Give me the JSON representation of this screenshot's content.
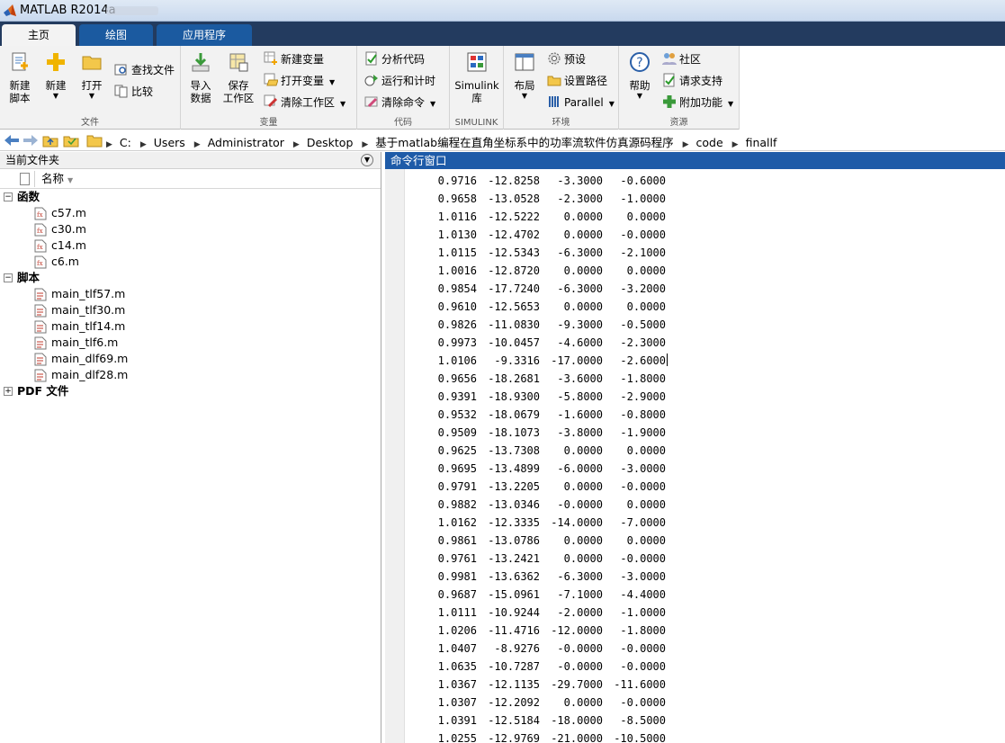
{
  "window": {
    "title": "MATLAB R2014a"
  },
  "tabs": [
    {
      "label": "主页",
      "active": true
    },
    {
      "label": "绘图",
      "active": false
    },
    {
      "label": "应用程序",
      "active": false
    }
  ],
  "ribbon": {
    "file_group": {
      "label": "文件",
      "new_script": "新建\n脚本",
      "new": "新建",
      "open": "打开",
      "find_files": "查找文件",
      "compare": "比较"
    },
    "variable_group": {
      "label": "变量",
      "import_data": "导入\n数据",
      "save_workspace": "保存\n工作区",
      "new_variable": "新建变量",
      "open_variable": "打开变量",
      "clear_workspace": "清除工作区"
    },
    "code_group": {
      "label": "代码",
      "analyze_code": "分析代码",
      "run_and_time": "运行和计时",
      "clear_commands": "清除命令"
    },
    "simulink_group": {
      "label": "SIMULINK",
      "simulink_library": "Simulink\n库"
    },
    "environment_group": {
      "label": "环境",
      "layout": "布局",
      "preferences": "预设",
      "set_path": "设置路径",
      "parallel": "Parallel"
    },
    "resources_group": {
      "label": "资源",
      "help": "帮助",
      "community": "社区",
      "request_support": "请求支持",
      "add_ons": "附加功能"
    }
  },
  "address": {
    "crumbs": [
      "C:",
      "Users",
      "Administrator",
      "Desktop",
      "基于matlab编程在直角坐标系中的功率流软件仿真源码程序",
      "code",
      "finallf"
    ]
  },
  "current_folder": {
    "title": "当前文件夹",
    "column_name": "名称",
    "sort_indicator": "▼",
    "sections": [
      {
        "label": "函数",
        "toggle": "−",
        "files": [
          "c57.m",
          "c30.m",
          "c14.m",
          "c6.m"
        ]
      },
      {
        "label": "脚本",
        "toggle": "−",
        "files": [
          "main_tlf57.m",
          "main_tlf30.m",
          "main_tlf14.m",
          "main_tlf6.m",
          "main_dlf69.m",
          "main_dlf28.m"
        ]
      },
      {
        "label": "PDF 文件",
        "toggle": "+",
        "files": []
      }
    ]
  },
  "command_window": {
    "title": "命令行窗口",
    "cursor_row": 10,
    "rows": [
      [
        "0.9716",
        "-12.8258",
        "-3.3000",
        "-0.6000"
      ],
      [
        "0.9658",
        "-13.0528",
        "-2.3000",
        "-1.0000"
      ],
      [
        "1.0116",
        "-12.5222",
        "0.0000",
        "0.0000"
      ],
      [
        "1.0130",
        "-12.4702",
        "0.0000",
        "-0.0000"
      ],
      [
        "1.0115",
        "-12.5343",
        "-6.3000",
        "-2.1000"
      ],
      [
        "1.0016",
        "-12.8720",
        "0.0000",
        "0.0000"
      ],
      [
        "0.9854",
        "-17.7240",
        "-6.3000",
        "-3.2000"
      ],
      [
        "0.9610",
        "-12.5653",
        "0.0000",
        "0.0000"
      ],
      [
        "0.9826",
        "-11.0830",
        "-9.3000",
        "-0.5000"
      ],
      [
        "0.9973",
        "-10.0457",
        "-4.6000",
        "-2.3000"
      ],
      [
        "1.0106",
        "-9.3316",
        "-17.0000",
        "-2.6000"
      ],
      [
        "0.9656",
        "-18.2681",
        "-3.6000",
        "-1.8000"
      ],
      [
        "0.9391",
        "-18.9300",
        "-5.8000",
        "-2.9000"
      ],
      [
        "0.9532",
        "-18.0679",
        "-1.6000",
        "-0.8000"
      ],
      [
        "0.9509",
        "-18.1073",
        "-3.8000",
        "-1.9000"
      ],
      [
        "0.9625",
        "-13.7308",
        "0.0000",
        "0.0000"
      ],
      [
        "0.9695",
        "-13.4899",
        "-6.0000",
        "-3.0000"
      ],
      [
        "0.9791",
        "-13.2205",
        "0.0000",
        "-0.0000"
      ],
      [
        "0.9882",
        "-13.0346",
        "-0.0000",
        "0.0000"
      ],
      [
        "1.0162",
        "-12.3335",
        "-14.0000",
        "-7.0000"
      ],
      [
        "0.9861",
        "-13.0786",
        "0.0000",
        "0.0000"
      ],
      [
        "0.9761",
        "-13.2421",
        "0.0000",
        "-0.0000"
      ],
      [
        "0.9981",
        "-13.6362",
        "-6.3000",
        "-3.0000"
      ],
      [
        "0.9687",
        "-15.0961",
        "-7.1000",
        "-4.4000"
      ],
      [
        "1.0111",
        "-10.9244",
        "-2.0000",
        "-1.0000"
      ],
      [
        "1.0206",
        "-11.4716",
        "-12.0000",
        "-1.8000"
      ],
      [
        "1.0407",
        "-8.9276",
        "-0.0000",
        "-0.0000"
      ],
      [
        "1.0635",
        "-10.7287",
        "-0.0000",
        "-0.0000"
      ],
      [
        "1.0367",
        "-12.1135",
        "-29.7000",
        "-11.6000"
      ],
      [
        "1.0307",
        "-12.2092",
        "0.0000",
        "-0.0000"
      ],
      [
        "1.0391",
        "-12.5184",
        "-18.0000",
        "-8.5000"
      ],
      [
        "1.0255",
        "-12.9769",
        "-21.0000",
        "-10.5000"
      ]
    ]
  }
}
